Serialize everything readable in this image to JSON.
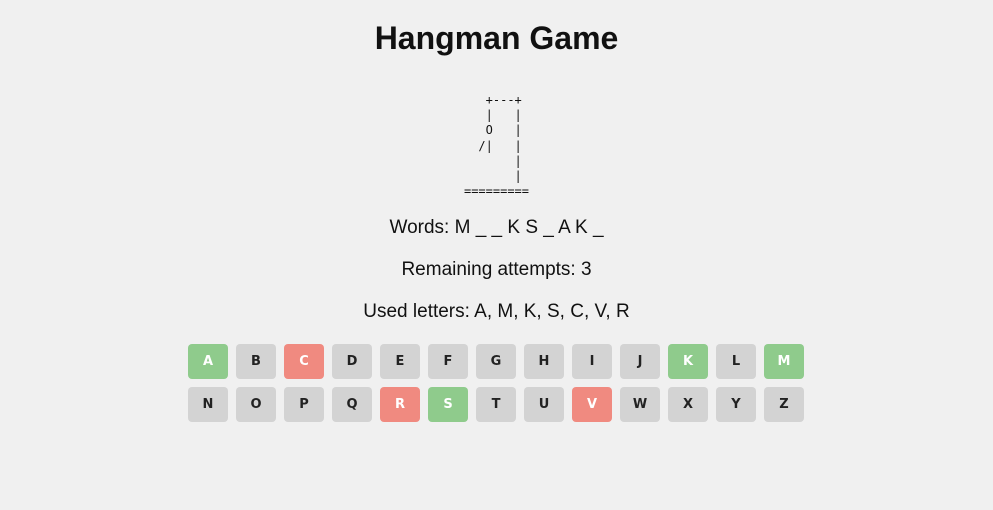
{
  "title": "Hangman Game",
  "gallows_art": "   +---+\n   |   |\n   O   |\n  /|   |\n       |\n       |\n=========",
  "word_line": "Words: M _ _ K S _ A K _",
  "remaining_line": "Remaining attempts: 3",
  "used_line": "Used letters: A, M, K, S, C, V, R",
  "colors": {
    "background": "#f0f0f0",
    "key_default": "#d3d3d3",
    "key_correct": "#8fcb8c",
    "key_wrong": "#f08a80"
  },
  "keyboard": {
    "rows": [
      [
        {
          "letter": "A",
          "state": "correct"
        },
        {
          "letter": "B",
          "state": "unused"
        },
        {
          "letter": "C",
          "state": "wrong"
        },
        {
          "letter": "D",
          "state": "unused"
        },
        {
          "letter": "E",
          "state": "unused"
        },
        {
          "letter": "F",
          "state": "unused"
        },
        {
          "letter": "G",
          "state": "unused"
        },
        {
          "letter": "H",
          "state": "unused"
        },
        {
          "letter": "I",
          "state": "unused"
        },
        {
          "letter": "J",
          "state": "unused"
        },
        {
          "letter": "K",
          "state": "correct"
        },
        {
          "letter": "L",
          "state": "unused"
        },
        {
          "letter": "M",
          "state": "correct"
        }
      ],
      [
        {
          "letter": "N",
          "state": "unused"
        },
        {
          "letter": "O",
          "state": "unused"
        },
        {
          "letter": "P",
          "state": "unused"
        },
        {
          "letter": "Q",
          "state": "unused"
        },
        {
          "letter": "R",
          "state": "wrong"
        },
        {
          "letter": "S",
          "state": "correct"
        },
        {
          "letter": "T",
          "state": "unused"
        },
        {
          "letter": "U",
          "state": "unused"
        },
        {
          "letter": "V",
          "state": "wrong"
        },
        {
          "letter": "W",
          "state": "unused"
        },
        {
          "letter": "X",
          "state": "unused"
        },
        {
          "letter": "Y",
          "state": "unused"
        },
        {
          "letter": "Z",
          "state": "unused"
        }
      ]
    ]
  }
}
